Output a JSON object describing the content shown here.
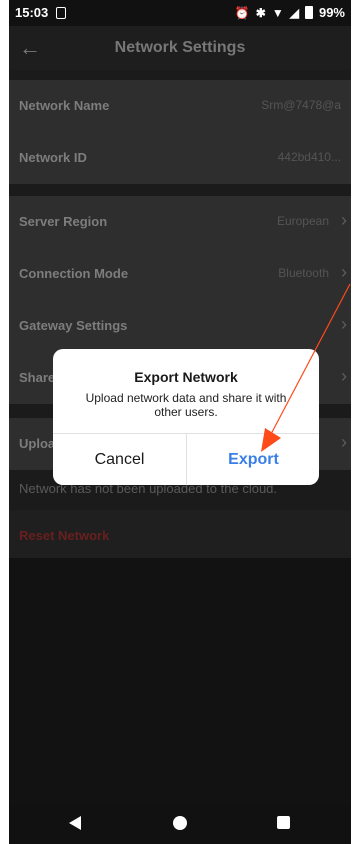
{
  "status_bar": {
    "time": "15:03",
    "battery": "99%"
  },
  "header": {
    "title": "Network Settings"
  },
  "settings": {
    "network_name": {
      "label": "Network Name",
      "value": "Srm@7478@a"
    },
    "network_id": {
      "label": "Network ID",
      "value": "442bd410..."
    },
    "server_region": {
      "label": "Server Region",
      "value": "European"
    },
    "connection_mode": {
      "label": "Connection Mode",
      "value": "Bluetooth"
    },
    "gateway_settings": {
      "label": "Gateway Settings"
    },
    "share": {
      "label": "Share"
    },
    "upload": {
      "label": "Uploa"
    },
    "upload_note": "Network has not been uploaded to the cloud.",
    "reset": {
      "label": "Reset Network"
    }
  },
  "dialog": {
    "title": "Export Network",
    "message": "Upload network data and share it with other users.",
    "cancel": "Cancel",
    "export": "Export"
  },
  "colors": {
    "accent": "#3a7fe6",
    "danger": "#6a1f1f",
    "annotation": "#ff4a1a"
  }
}
